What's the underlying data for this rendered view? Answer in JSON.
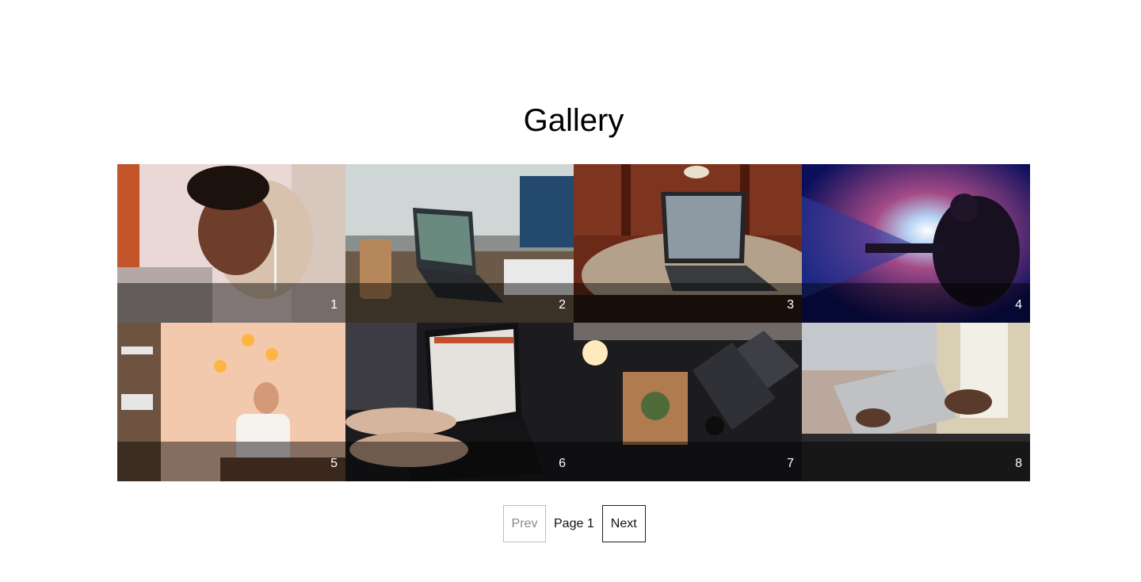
{
  "page": {
    "title": "Gallery"
  },
  "gallery": {
    "items": [
      {
        "number": "1",
        "subject": "man with earbuds smiling"
      },
      {
        "number": "2",
        "subject": "laptop in cafe with iced coffee"
      },
      {
        "number": "3",
        "subject": "laptop on round wooden table"
      },
      {
        "number": "4",
        "subject": "person in light beam"
      },
      {
        "number": "5",
        "subject": "woman at cafe counter with lamps"
      },
      {
        "number": "6",
        "subject": "hands typing on laptop"
      },
      {
        "number": "7",
        "subject": "laptop, plant and candle top view"
      },
      {
        "number": "8",
        "subject": "person holding tablet"
      }
    ]
  },
  "pagination": {
    "prev_label": "Prev",
    "page_label": "Page 1",
    "next_label": "Next"
  },
  "colors": {
    "caption_overlay": "#000000",
    "caption_text": "#ffffff",
    "disabled_text": "#8a8a8a"
  }
}
